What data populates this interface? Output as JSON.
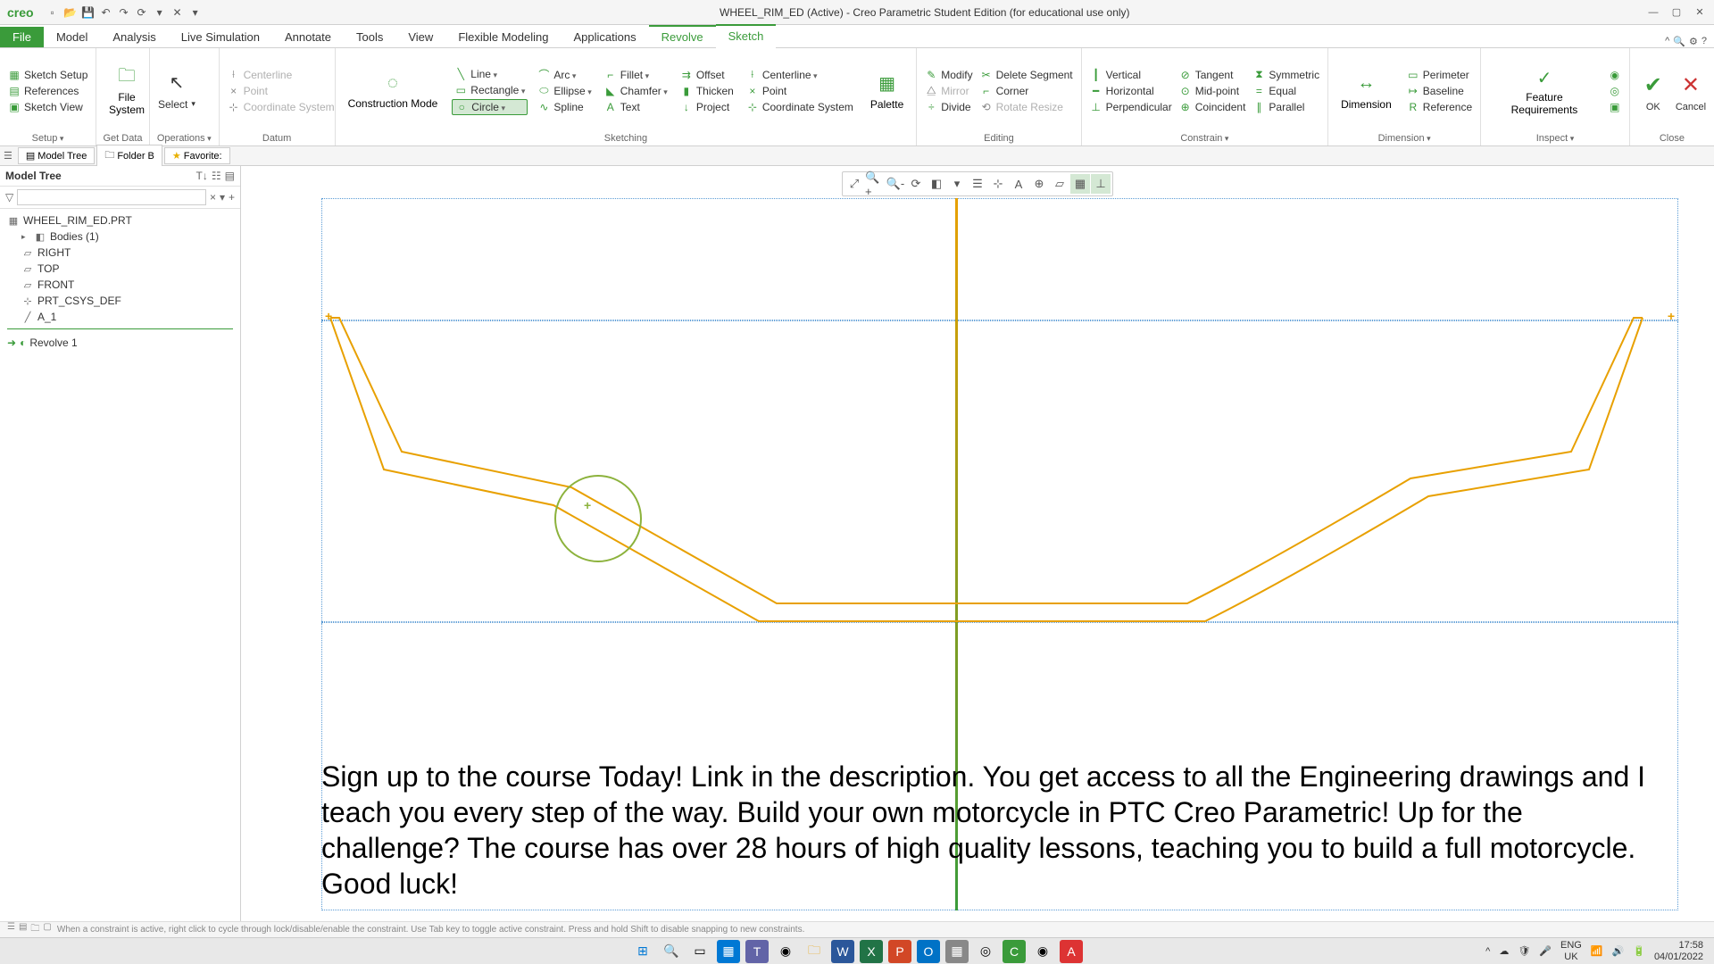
{
  "app": {
    "brand": "creo",
    "title": "WHEEL_RIM_ED (Active) - Creo Parametric Student Edition (for educational use only)"
  },
  "tabs": {
    "file": "File",
    "model": "Model",
    "analysis": "Analysis",
    "livesim": "Live Simulation",
    "annotate": "Annotate",
    "tools": "Tools",
    "view": "View",
    "flex": "Flexible Modeling",
    "apps": "Applications",
    "revolve": "Revolve",
    "sketch": "Sketch"
  },
  "setup": {
    "sketch_setup": "Sketch Setup",
    "references": "References",
    "sketch_view": "Sketch View",
    "setup": "Setup",
    "get_data": "Get Data",
    "operations": "Operations"
  },
  "getdata": {
    "file_system": "File\nSystem"
  },
  "ops": {
    "select": "Select"
  },
  "datum": {
    "centerline": "Centerline",
    "point": "Point",
    "coord": "Coordinate System",
    "construction_mode": "Construction\nMode",
    "label": "Datum"
  },
  "sketching": {
    "line": "Line",
    "arc": "Arc",
    "rectangle": "Rectangle",
    "ellipse": "Ellipse",
    "circle": "Circle",
    "spline": "Spline",
    "fillet": "Fillet",
    "chamfer": "Chamfer",
    "text": "Text",
    "offset": "Offset",
    "thicken": "Thicken",
    "project": "Project",
    "centerline2": "Centerline",
    "point2": "Point",
    "coord2": "Coordinate System",
    "palette": "Palette",
    "label": "Sketching"
  },
  "editing": {
    "modify": "Modify",
    "mirror": "Mirror",
    "divide": "Divide",
    "delete_segment": "Delete Segment",
    "corner": "Corner",
    "rotate_resize": "Rotate Resize",
    "label": "Editing"
  },
  "constrain": {
    "vertical": "Vertical",
    "horizontal": "Horizontal",
    "perpendicular": "Perpendicular",
    "tangent": "Tangent",
    "midpoint": "Mid-point",
    "coincident": "Coincident",
    "symmetric": "Symmetric",
    "equal": "Equal",
    "parallel": "Parallel",
    "label": "Constrain"
  },
  "dimension": {
    "dimension": "Dimension",
    "perimeter": "Perimeter",
    "baseline": "Baseline",
    "reference": "Reference",
    "label": "Dimension"
  },
  "inspect": {
    "feature_req": "Feature\nRequirements",
    "label": "Inspect"
  },
  "close": {
    "ok": "OK",
    "cancel": "Cancel",
    "label": "Close"
  },
  "nav": {
    "model_tree": "Model Tree",
    "folder_b": "Folder B",
    "favorites": "Favorite:"
  },
  "tree": {
    "title": "Model Tree",
    "root": "WHEEL_RIM_ED.PRT",
    "bodies": "Bodies (1)",
    "right": "RIGHT",
    "top": "TOP",
    "front": "FRONT",
    "csys": "PRT_CSYS_DEF",
    "a1": "A_1",
    "revolve1": "Revolve 1"
  },
  "overlay": "Sign up to the course Today! Link in the description. You get access to all the Engineering drawings and I teach you every step of the way.  Build your own motorcycle in PTC Creo Parametric! Up for the challenge? The course has over 28 hours of high quality lessons, teaching you to build a full motorcycle. Good luck!",
  "status": {
    "hint": "When a constraint is active, right click to cycle through lock/disable/enable the constraint. Use Tab key to toggle active constraint. Press and hold Shift to disable snapping to new constraints."
  },
  "systray": {
    "lang": "ENG",
    "region": "UK",
    "time": "17:58",
    "date": "04/01/2022"
  }
}
